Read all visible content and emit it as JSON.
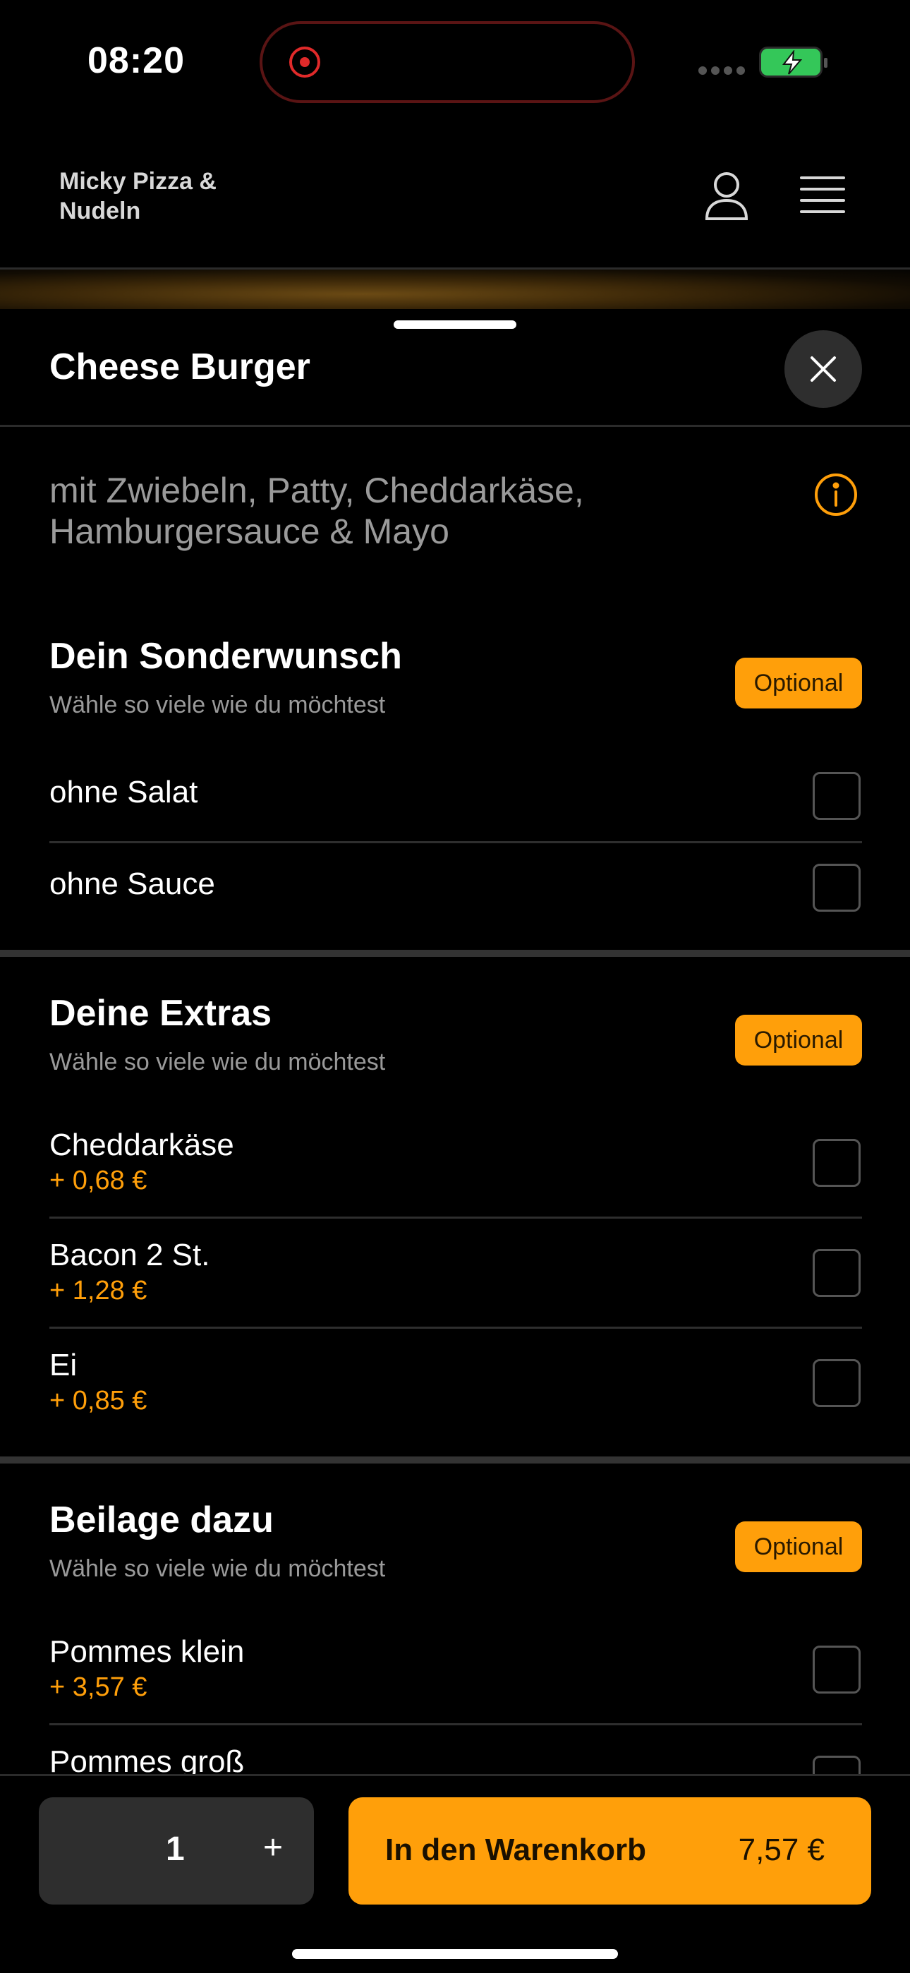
{
  "status_bar": {
    "time": "08:20"
  },
  "header": {
    "brand": "Micky Pizza & Nudeln"
  },
  "sheet": {
    "title": "Cheese Burger",
    "description": "mit Zwiebeln, Patty, Cheddarkäse, Hamburgersauce & Mayo"
  },
  "sections": [
    {
      "title": "Dein Sonderwunsch",
      "subtitle": "Wähle so viele wie du möchtest",
      "badge": "Optional",
      "options": [
        {
          "label": "ohne Salat"
        },
        {
          "label": "ohne Sauce"
        }
      ]
    },
    {
      "title": "Deine Extras",
      "subtitle": "Wähle so viele wie du möchtest",
      "badge": "Optional",
      "options": [
        {
          "label": "Cheddarkäse",
          "price": "+ 0,68 €"
        },
        {
          "label": "Bacon 2 St.",
          "price": "+ 1,28 €"
        },
        {
          "label": "Ei",
          "price": "+ 0,85 €"
        }
      ]
    },
    {
      "title": "Beilage dazu",
      "subtitle": "Wähle so viele wie du möchtest",
      "badge": "Optional",
      "options": [
        {
          "label": "Pommes klein",
          "price": "+ 3,57 €"
        },
        {
          "label": "Pommes groß"
        }
      ]
    }
  ],
  "bottom_bar": {
    "quantity": "1",
    "plus_label": "+",
    "cart_label": "In den Warenkorb",
    "cart_price": "7,57 €"
  },
  "colors": {
    "accent": "#ff9f0a",
    "background": "#000000",
    "battery": "#34c759"
  }
}
